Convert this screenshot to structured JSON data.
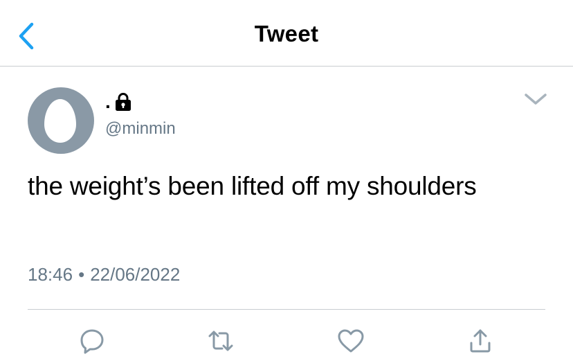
{
  "header": {
    "title": "Tweet",
    "back_icon": "chevron-left-icon"
  },
  "tweet": {
    "author": {
      "display_name": ".",
      "handle": "@minmin",
      "protected_icon": "lock-icon",
      "avatar": "default-egg-avatar"
    },
    "text": "the weight’s been lifted off my shoulders",
    "time": "18:46",
    "separator": "•",
    "date": "22/06/2022",
    "menu_icon": "chevron-down-icon"
  },
  "actions": [
    {
      "name": "reply",
      "icon": "reply-icon"
    },
    {
      "name": "retweet",
      "icon": "retweet-icon"
    },
    {
      "name": "like",
      "icon": "heart-icon"
    },
    {
      "name": "share",
      "icon": "share-icon"
    }
  ],
  "colors": {
    "accent": "#1da1f2",
    "secondary_text": "#657786",
    "icon_gray": "#8899a6",
    "divider": "#c8ccd0",
    "avatar_bg": "#8a99a6"
  }
}
